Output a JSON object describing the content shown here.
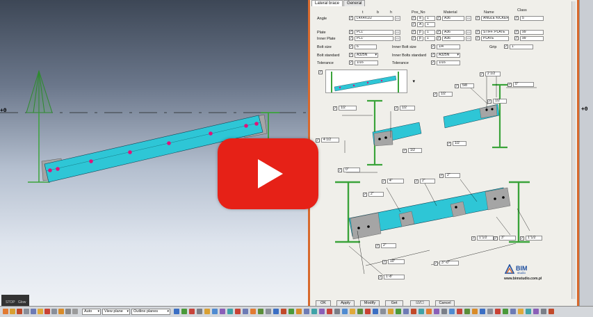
{
  "viewport": {
    "axis_left": "+0",
    "axis_right": "+0"
  },
  "status": {
    "stop": "STOP",
    "glow": "Glow"
  },
  "dialog": {
    "tabs": [
      "Lateral brace",
      "General"
    ],
    "col_headers": {
      "t": "t",
      "b": "b",
      "h": "h",
      "pos_no": "Pos_No",
      "material": "Material",
      "name": "Name",
      "class": "Class"
    },
    "rows": [
      {
        "label": "Angle",
        "profile": "L4X4X1/2",
        "pos_prefix": "a",
        "pos_no": "1",
        "material": "A36",
        "name": "ANGLE KICKER",
        "class": "5"
      },
      {
        "label": "",
        "profile": "",
        "pos_prefix": "A",
        "pos_no": "1",
        "material": "",
        "name": "",
        "class": ""
      },
      {
        "label": "Plate",
        "profile": "PL1\"",
        "pos_prefix": "p",
        "pos_no": "1",
        "material": "A36",
        "name": "STIFF. PLATE",
        "class": "99"
      },
      {
        "label": "Inner Plate",
        "profile": "PL1\"",
        "pos_prefix": "p",
        "pos_no": "1",
        "material": "A36",
        "name": "PLATE",
        "class": "99"
      }
    ],
    "bolt_size_label": "Bolt size",
    "bolt_size": "6",
    "inner_bolt_size_label": "Inner Bolt size",
    "inner_bolt_size": "1/4",
    "grip_label": "Grip",
    "grip": "1\"",
    "bolt_standard_label": "Bolt standard",
    "bolt_standard": "A325N",
    "inner_bolt_standard_label": "Inner Bolts standard",
    "inner_bolt_standard": "A325N",
    "tolerance_label": "Tolerance",
    "tolerance": "1/16",
    "inner_tolerance_label": "Tolerance",
    "inner_tolerance": "1/16",
    "dims": {
      "left_top1": "1/2",
      "left_top2": "1/2",
      "left_side": "4 1/2",
      "left_bot1": "1/2",
      "left_bot2": "0\"",
      "right_top": "2 1/2",
      "right_mid": "5/8",
      "right_0": "0\"",
      "right_1_2a": "1/2",
      "right_1_2b": "1/2",
      "right_1_2c": "1/2",
      "bot_4": "4\"",
      "bot_2a": "2\"",
      "bot_2b": "2\"",
      "bot_2c": "2\"",
      "bot_2d": "2\"",
      "bot_10": "10\"",
      "bot_total": "3'\"-0\"",
      "bot_1_8": "1'-8\"",
      "bot_112a": "1\"1/2",
      "bot_3": "3\"",
      "bot_112b": "1\"1/2"
    },
    "logo_text": "BIM",
    "logo_sub": "studio",
    "logo_url": "www.bimstudio.com.pl",
    "buttons": {
      "ok": "OK",
      "apply": "Apply",
      "modify": "Modify",
      "get": "Get",
      "toggle": "☑/☐",
      "cancel": "Cancel"
    }
  },
  "taskbar": {
    "auto": "Auto",
    "view_plane": "View plane",
    "outline_planes": "Outline planes"
  },
  "colors": {
    "beam": "#2ec6d6",
    "bolt": "#e0137a",
    "column": "#3aa33a",
    "accent": "#d8692d",
    "youtube": "#e62117"
  }
}
